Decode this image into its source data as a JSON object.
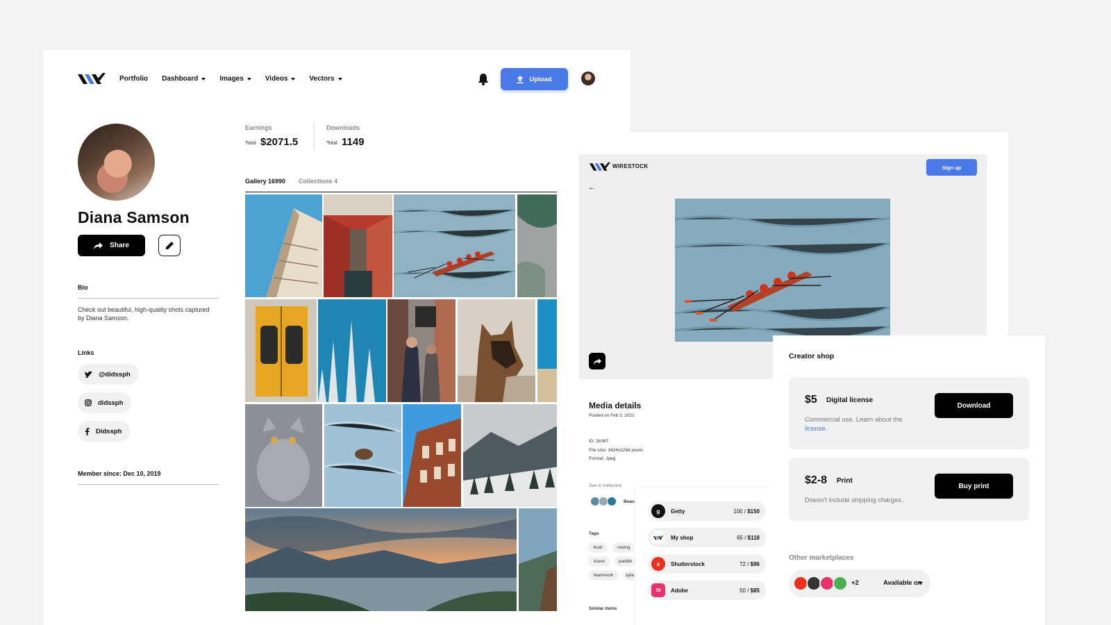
{
  "header": {
    "nav": [
      {
        "label": "Portfolio",
        "has_dropdown": false
      },
      {
        "label": "Dashboard",
        "has_dropdown": true
      },
      {
        "label": "Images",
        "has_dropdown": true
      },
      {
        "label": "Videos",
        "has_dropdown": true
      },
      {
        "label": "Vectors",
        "has_dropdown": true
      }
    ],
    "upload_label": "Upload"
  },
  "profile": {
    "name": "Diana Samson",
    "share_label": "Share",
    "bio_title": "Bio",
    "bio_text": "Check out beautiful, high-quality shots captured by Diana Samson.",
    "links_title": "Links",
    "links": [
      {
        "icon": "twitter-icon",
        "label": "@didssph"
      },
      {
        "icon": "instagram-icon",
        "label": "didssph"
      },
      {
        "icon": "facebook-icon",
        "label": "Didssph"
      }
    ],
    "member_since": "Member since: Dec 10, 2019"
  },
  "stats": {
    "earnings_label": "Earnings",
    "earnings_total_label": "Total",
    "earnings_value": "$2071.5",
    "downloads_label": "Downloads",
    "downloads_total_label": "Total",
    "downloads_value": "1149"
  },
  "tabs": [
    {
      "label": "Gallery 16990",
      "active": true
    },
    {
      "label": "Collections 4",
      "active": false
    }
  ],
  "detail": {
    "brand": "WIRESTOCK",
    "signup_label": "Sign up",
    "back": "←",
    "media_details_title": "Media details",
    "posted_on": "Posted on Feb 3, 2022",
    "id": "ID: 26367",
    "file_size": "File size: 3424x2268 pixels",
    "format": "Format: Jpeg",
    "see_in_collection": "See in collection",
    "collection_name": "Beau",
    "tags_title": "Tags",
    "tags": [
      "boat",
      "rowing",
      "travel",
      "paddle",
      "teamwork",
      "spla"
    ],
    "similar_items": "Similar items"
  },
  "marketplaces": [
    {
      "name": "Getty",
      "count": "100",
      "amount": "$150",
      "color": "#111111",
      "glyph": "g"
    },
    {
      "name": "My shop",
      "count": "65",
      "amount": "$118",
      "color": "#ffffff",
      "glyph": ""
    },
    {
      "name": "Shutterstock",
      "count": "72",
      "amount": "$96",
      "color": "#e8321f",
      "glyph": "s"
    },
    {
      "name": "Adobe",
      "count": "50",
      "amount": "$85",
      "color": "#e8336a",
      "glyph": "St"
    }
  ],
  "shop": {
    "title": "Creator shop",
    "digital": {
      "price": "$5",
      "type": "Digital license",
      "desc": "Commercial use. Learn about the",
      "link": "license.",
      "button": "Download"
    },
    "print": {
      "price": "$2-8",
      "type": "Print",
      "desc": "Doesn't include shipping charges.",
      "button": "Buy print"
    },
    "other_title": "Other marketplaces",
    "more_count": "+2",
    "available_label": "Available on"
  },
  "colors": {
    "accent": "#4a79e8",
    "background": "#f2f2f3",
    "pill": "#f1f1f1"
  }
}
